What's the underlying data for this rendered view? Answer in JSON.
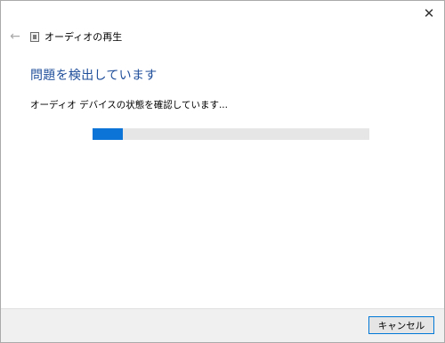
{
  "window": {
    "close_glyph": "✕"
  },
  "nav": {
    "back_glyph": "←",
    "title": "オーディオの再生"
  },
  "main": {
    "heading": "問題を検出しています",
    "status": "オーディオ デバイスの状態を確認しています..."
  },
  "progress": {
    "fraction": 0.11
  },
  "footer": {
    "cancel_label": "キャンセル"
  },
  "colors": {
    "accent": "#0b74d6",
    "heading": "#1f4e9a",
    "track": "#e6e6e6",
    "footer_bg": "#f0f0f0"
  },
  "icons": {
    "back": "back-arrow-icon",
    "app": "troubleshooter-app-icon",
    "close": "close-icon"
  }
}
